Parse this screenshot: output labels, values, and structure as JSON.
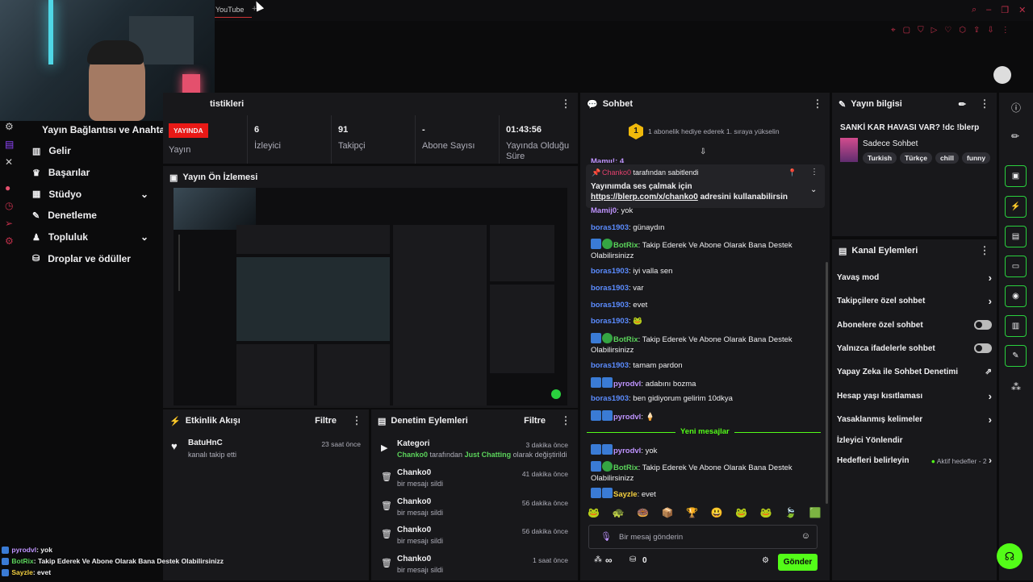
{
  "browser": {
    "tab_label": "YouTube"
  },
  "sidebar": {
    "title": "Yayın Bağlantısı ve Anahtarı",
    "items": [
      {
        "label": "Gelir",
        "icon": "chart-icon"
      },
      {
        "label": "Başarılar",
        "icon": "trophy-icon"
      },
      {
        "label": "Stüdyo",
        "icon": "film-icon",
        "expand": true
      },
      {
        "label": "Denetleme",
        "icon": "wrench-icon"
      },
      {
        "label": "Topluluk",
        "icon": "people-icon",
        "expand": true
      },
      {
        "label": "Droplar ve ödüller",
        "icon": "gift-icon"
      }
    ]
  },
  "stats": {
    "title": "tistikleri",
    "live_badge": "YAYINDA",
    "items": [
      {
        "value": "",
        "label": "Yayın"
      },
      {
        "value": "6",
        "label": "İzleyici"
      },
      {
        "value": "91",
        "label": "Takipçi"
      },
      {
        "value": "-",
        "label": "Abone Sayısı"
      },
      {
        "value": "01:43:56",
        "label": "Yayında Olduğu Süre"
      }
    ]
  },
  "preview": {
    "title": "Yayın Ön İzlemesi"
  },
  "activity": {
    "title": "Etkinlik Akışı",
    "filter": "Filtre",
    "events": [
      {
        "user": "BatuHnC",
        "desc": "kanalı takip etti",
        "time": "23 saat önce"
      }
    ]
  },
  "moderation": {
    "title": "Denetim Eylemleri",
    "filter": "Filtre",
    "rows": [
      {
        "title": "Kategori",
        "time": "3 dakika önce",
        "user": "Chanko0",
        "mid": " tarafından ",
        "cat": "Just Chatting",
        "rest": " olarak değiştirildi",
        "icon": "category-icon"
      },
      {
        "title": "Chanko0",
        "time": "41 dakika önce",
        "desc": "bir mesajı sildi",
        "icon": "trash-icon"
      },
      {
        "title": "Chanko0",
        "time": "56 dakika önce",
        "desc": "bir mesajı sildi",
        "icon": "trash-icon"
      },
      {
        "title": "Chanko0",
        "time": "56 dakika önce",
        "desc": "bir mesajı sildi",
        "icon": "trash-icon"
      },
      {
        "title": "Chanko0",
        "time": "1 saat önce",
        "desc": "bir mesajı sildi",
        "icon": "trash-icon"
      }
    ]
  },
  "chat": {
    "title": "Sohbet",
    "hype": {
      "rank": "1",
      "text": "1 abonelik hediye ederek 1. sıraya yükselin"
    },
    "pinned": {
      "by": "Chanko0",
      "by_suffix": " tarafından sabitlendi",
      "text_prefix": "Yayınımda ses çalmak için ",
      "link": "https://blerp.com/x/chanko0",
      "text_suffix": " adresini kullanabilirsin"
    },
    "partial_line": "Mamıı!: 4",
    "messages": [
      {
        "user": "Mamij0",
        "color": "purple",
        "text": ": yok"
      },
      {
        "user": "boras1903",
        "color": "blue",
        "text": ": günaydın"
      },
      {
        "user": "BotRix",
        "color": "green",
        "text": ": Takip Ederek Ve Abone Olarak Bana Destek Olabilirsinizz",
        "badges": true
      },
      {
        "user": "boras1903",
        "color": "blue",
        "text": ": iyi valla sen"
      },
      {
        "user": "boras1903",
        "color": "blue",
        "text": ": var"
      },
      {
        "user": "boras1903",
        "color": "blue",
        "text": ": evet"
      },
      {
        "user": "boras1903",
        "color": "blue",
        "text": ": 🐸"
      },
      {
        "user": "BotRix",
        "color": "green",
        "text": ": Takip Ederek Ve Abone Olarak Bana Destek Olabilirsinizz",
        "badges": true
      },
      {
        "user": "boras1903",
        "color": "blue",
        "text": ": tamam pardon"
      },
      {
        "user": "pyrodvl",
        "color": "purple",
        "text": ": adabını bozma",
        "badges": true
      },
      {
        "user": "boras1903",
        "color": "blue",
        "text": ": ben gidiyorum gelirim 10dkya"
      },
      {
        "user": "pyrodvl",
        "color": "purple",
        "text": ": 🍦",
        "badges": true
      }
    ],
    "new_messages": "Yeni mesajlar",
    "messages_after": [
      {
        "user": "pyrodvl",
        "color": "purple",
        "text": ": yok",
        "badges": true
      },
      {
        "user": "BotRix",
        "color": "green",
        "text": ": Takip Ederek Ve Abone Olarak Bana Destek Olabilirsinizz",
        "badges": true
      },
      {
        "user": "Sayzle",
        "color": "yellow",
        "text": ": evet",
        "badges": true
      }
    ],
    "emotes": [
      "🐸",
      "🐢",
      "🍩",
      "📦",
      "🏆",
      "😃",
      "🐸",
      "🐸",
      "🍃",
      "🟩"
    ],
    "input_placeholder": "Bir mesaj gönderin",
    "points": "∞",
    "count": "0",
    "send": "Gönder"
  },
  "stream_info": {
    "title": "Yayın bilgisi",
    "stream_title": "SANKİ KAR HAVASI VAR? !dc !blerp",
    "category": "Sadece Sohbet",
    "tags": [
      "Turkish",
      "Türkçe",
      "chill",
      "funny"
    ]
  },
  "channel_actions": {
    "title": "Kanal Eylemleri",
    "rows": [
      {
        "label": "Yavaş mod",
        "type": "chevron"
      },
      {
        "label": "Takipçilere özel sohbet",
        "type": "chevron"
      },
      {
        "label": "Abonelere özel sohbet",
        "type": "toggle"
      },
      {
        "label": "Yalnızca ifadelerle sohbet",
        "type": "toggle"
      },
      {
        "label": "Yapay Zeka ile Sohbet Denetimi",
        "type": "external"
      },
      {
        "label": "Hesap yaşı kısıtlaması",
        "type": "chevron"
      },
      {
        "label": "Yasaklanmış kelimeler",
        "type": "chevron"
      },
      {
        "label": "İzleyici Yönlendir",
        "type": "none"
      },
      {
        "label": "Hedefleri belirleyin",
        "type": "goal",
        "extra": "Aktif hedefler - 2"
      }
    ]
  },
  "overlay_chat": [
    {
      "user": "pyrodvl",
      "text": ": yok",
      "color": "#bf94ff"
    },
    {
      "user": "BotRix",
      "text": ": Takip Ederek Ve Abone Olarak Bana Destek Olabilirsinizz",
      "color": "#5bd35b"
    },
    {
      "user": "Sayzle",
      "text": ": evet",
      "color": "#f4d03f"
    }
  ],
  "colors": {
    "accent": "#53fc18",
    "brand_border": "#2ad13e",
    "live": "#e91916",
    "bg": "#0b0b0c",
    "panel": "#18181b"
  }
}
